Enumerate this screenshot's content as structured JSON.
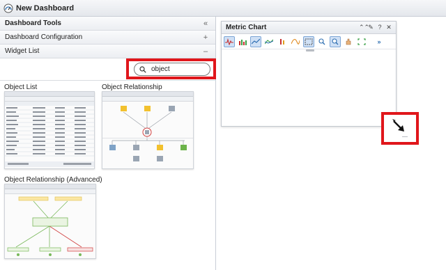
{
  "window": {
    "title": "New Dashboard"
  },
  "tools": {
    "header": "Dashboard Tools",
    "collapse_glyph": "«",
    "sections": [
      {
        "label": "Dashboard Configuration",
        "control": "+"
      },
      {
        "label": "Widget List",
        "control": "–"
      }
    ],
    "search": {
      "value": "object"
    },
    "widgets": [
      {
        "label": "Object List"
      },
      {
        "label": "Object Relationship"
      },
      {
        "label": "Object Relationship (Advanced)"
      }
    ]
  },
  "metric_chart": {
    "title": "Metric Chart",
    "header_controls": [
      "⌃⌃",
      "✎",
      "?",
      "✕"
    ],
    "toolbar": [
      "pulse-icon",
      "bar-icon",
      "trend-icon",
      "compare-icon",
      "stack-icon",
      "curve-icon",
      "select-icon",
      "zoom-icon",
      "zoom-fit-icon",
      "pan-icon",
      "fullscreen-icon"
    ],
    "more_glyph": "»"
  },
  "colors": {
    "highlight": "#e0161b",
    "accent": "#2b6cb0"
  }
}
